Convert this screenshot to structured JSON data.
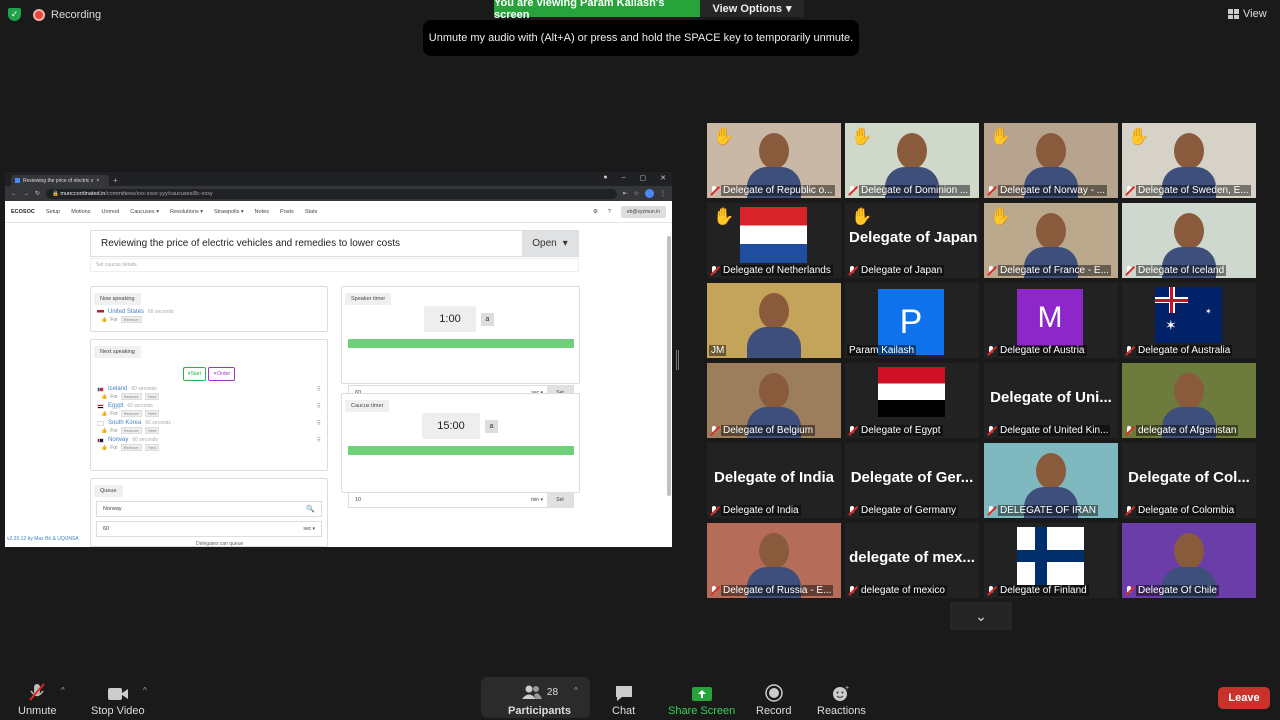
{
  "zoom": {
    "recording_label": "Recording",
    "viewing_banner": "You are viewing Param Kailash's screen",
    "view_options": "View Options",
    "unmute_tip": "Unmute my audio with (Alt+A) or press and hold the SPACE key to temporarily unmute.",
    "view_label": "View"
  },
  "browser": {
    "tab_title": "Reviewing the price of electric v",
    "url_host": "munccordinated.in",
    "url_path": "/committees/xxx-xxxx-yyy/caucuses/8c-xxxy"
  },
  "app": {
    "nav": [
      "ECOSOC",
      "Setup",
      "Motions",
      "Unmod",
      "Caucuses ▾",
      "Resolutions ▾",
      "Strawpolls ▾",
      "Notes",
      "Posts",
      "Stats"
    ],
    "email": "eb@xyzmun.in",
    "topic": "Reviewing the price of electric vehicles and remedies to lower costs",
    "status": "Open",
    "desc_placeholder": "Set caucus details",
    "now_speaking_label": "Now speaking",
    "now_speaker": "United States",
    "now_speaker_time": "60 seconds",
    "for_label": "For",
    "remove_tag": "Remove",
    "next_speaking_label": "Next speaking",
    "start_label": "Start",
    "order_label": "Order",
    "queue_speakers": [
      {
        "name": "Iceland",
        "time": "60 seconds"
      },
      {
        "name": "Egypt",
        "time": "60 seconds"
      },
      {
        "name": "South Korea",
        "time": "60 seconds"
      },
      {
        "name": "Norway",
        "time": "60 seconds"
      }
    ],
    "queue_label": "Queue",
    "queue_input": "Norway",
    "queue_time": "60",
    "queue_unit": "sec ▾",
    "queue_footer": "Delegates can queue",
    "speaker_timer_label": "Speaker timer",
    "speaker_timer": "1:00",
    "speaker_input": "60",
    "speaker_unit": "sec ▾",
    "set_label": "Set",
    "caucus_timer_label": "Caucus timer",
    "caucus_timer": "15:00",
    "caucus_input": "10",
    "caucus_unit": "min ▾",
    "timer_btn": "a",
    "footer": "v2.20.12 by Max Bö & UQUNSA"
  },
  "participants": [
    {
      "name": "Delegate of Republic o...",
      "hand": true,
      "type": "video"
    },
    {
      "name": "Delegate of Dominion ...",
      "hand": true,
      "type": "video"
    },
    {
      "name": "Delegate of Norway - ...",
      "hand": true,
      "type": "video"
    },
    {
      "name": "Delegate of Sweden, E...",
      "hand": true,
      "type": "video"
    },
    {
      "name": "Delegate of Netherlands",
      "hand": true,
      "type": "flag-nl"
    },
    {
      "name": "Delegate of Japan",
      "hand": true,
      "type": "text",
      "big": "Delegate of Japan"
    },
    {
      "name": "Delegate of France - E...",
      "hand": true,
      "type": "video"
    },
    {
      "name": "Delegate of Iceland",
      "hand": false,
      "type": "video"
    },
    {
      "name": "JM",
      "hand": false,
      "type": "video",
      "active": true
    },
    {
      "name": "Param Kailash",
      "hand": false,
      "type": "avatar",
      "letter": "P"
    },
    {
      "name": "Delegate of Austria",
      "hand": false,
      "type": "avatar-m",
      "letter": "M"
    },
    {
      "name": "Delegate of Australia",
      "hand": false,
      "type": "flag-au"
    },
    {
      "name": "Delegate of Belgium",
      "hand": false,
      "type": "video"
    },
    {
      "name": "Delegate of Egypt",
      "hand": false,
      "type": "flag-eg"
    },
    {
      "name": "Delegate of United Kin...",
      "hand": false,
      "type": "text",
      "big": "Delegate of Uni..."
    },
    {
      "name": "delegate of Afgsnistan",
      "hand": false,
      "type": "video"
    },
    {
      "name": "Delegate of India",
      "hand": false,
      "type": "text",
      "big": "Delegate of India"
    },
    {
      "name": "Delegate of Germany",
      "hand": false,
      "type": "text",
      "big": "Delegate of Ger..."
    },
    {
      "name": "DELEGATE OF IRAN",
      "hand": false,
      "type": "video"
    },
    {
      "name": "Delegate of Colombia",
      "hand": false,
      "type": "text",
      "big": "Delegate of Col..."
    },
    {
      "name": "Delegate of Russia - E...",
      "hand": false,
      "type": "video"
    },
    {
      "name": "delegate of mexico",
      "hand": false,
      "type": "text",
      "big": "delegate of mex..."
    },
    {
      "name": "Delegate of Finland",
      "hand": false,
      "type": "flag-fi"
    },
    {
      "name": "Delegate Of Chile",
      "hand": false,
      "type": "video"
    }
  ],
  "toolbar": {
    "unmute": "Unmute",
    "stop_video": "Stop Video",
    "participants": "Participants",
    "participant_count": "28",
    "chat": "Chat",
    "share_screen": "Share Screen",
    "record": "Record",
    "reactions": "Reactions",
    "leave": "Leave"
  },
  "colors": {
    "zoom_green": "#26a33a",
    "leave_red": "#c8322a",
    "active_speaker": "#c8e045",
    "timer_bar": "#6fd07a"
  }
}
